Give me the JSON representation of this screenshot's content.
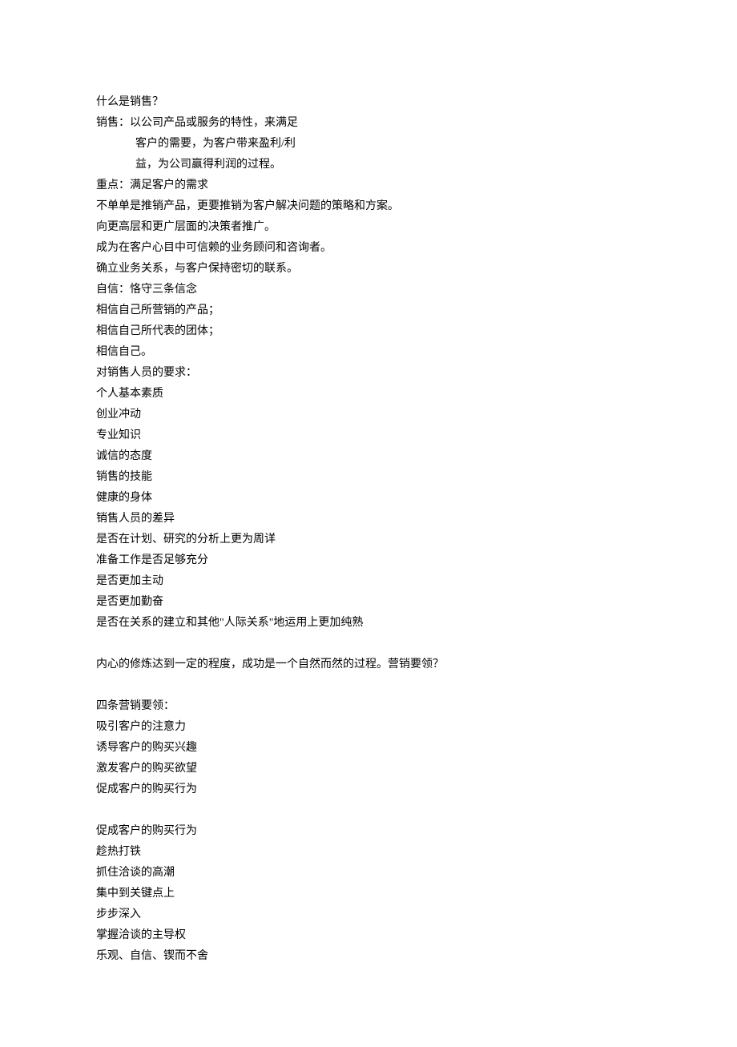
{
  "document": {
    "lines": [
      {
        "text": "什么是销售？",
        "indent": false
      },
      {
        "text": "销售：以公司产品或服务的特性，来满足",
        "indent": false
      },
      {
        "text": "客户的需要，为客户带来盈利/利",
        "indent": true
      },
      {
        "text": "益，为公司赢得利润的过程。",
        "indent": true
      },
      {
        "text": "重点：满足客户的需求",
        "indent": false
      },
      {
        "text": "不单单是推销产品，更要推销为客户解决问题的策略和方案。",
        "indent": false
      },
      {
        "text": "向更高层和更广层面的决策者推广。",
        "indent": false
      },
      {
        "text": "成为在客户心目中可信赖的业务顾问和咨询者。",
        "indent": false
      },
      {
        "text": "确立业务关系，与客户保持密切的联系。",
        "indent": false
      },
      {
        "text": "自信：恪守三条信念",
        "indent": false
      },
      {
        "text": "相信自己所营销的产品；",
        "indent": false
      },
      {
        "text": "相信自己所代表的团体；",
        "indent": false
      },
      {
        "text": "相信自己。",
        "indent": false
      },
      {
        "text": "对销售人员的要求：",
        "indent": false
      },
      {
        "text": "个人基本素质",
        "indent": false
      },
      {
        "text": "创业冲动",
        "indent": false
      },
      {
        "text": "专业知识",
        "indent": false
      },
      {
        "text": "诚信的态度",
        "indent": false
      },
      {
        "text": "销售的技能",
        "indent": false
      },
      {
        "text": "健康的身体",
        "indent": false
      },
      {
        "text": "销售人员的差异",
        "indent": false
      },
      {
        "text": "是否在计划、研究的分析上更为周详",
        "indent": false
      },
      {
        "text": "准备工作是否足够充分",
        "indent": false
      },
      {
        "text": "是否更加主动",
        "indent": false
      },
      {
        "text": "是否更加勤奋",
        "indent": false
      },
      {
        "text": "是否在关系的建立和其他\"人际关系\"地运用上更加纯熟",
        "indent": false
      },
      {
        "blank": true
      },
      {
        "text": "内心的修炼达到一定的程度，成功是一个自然而然的过程。营销要领？",
        "indent": false
      },
      {
        "blank": true
      },
      {
        "text": "四条营销要领：",
        "indent": false
      },
      {
        "text": "吸引客户的注意力",
        "indent": false
      },
      {
        "text": "诱导客户的购买兴趣",
        "indent": false
      },
      {
        "text": "激发客户的购买欲望",
        "indent": false
      },
      {
        "text": "促成客户的购买行为",
        "indent": false
      },
      {
        "blank": true
      },
      {
        "text": "促成客户的购买行为",
        "indent": false
      },
      {
        "text": "趁热打铁",
        "indent": false
      },
      {
        "text": "抓住洽谈的高潮",
        "indent": false
      },
      {
        "text": "集中到关键点上",
        "indent": false
      },
      {
        "text": "步步深入",
        "indent": false
      },
      {
        "text": "掌握洽谈的主导权",
        "indent": false
      },
      {
        "text": "乐观、自信、锲而不舍",
        "indent": false
      }
    ]
  }
}
